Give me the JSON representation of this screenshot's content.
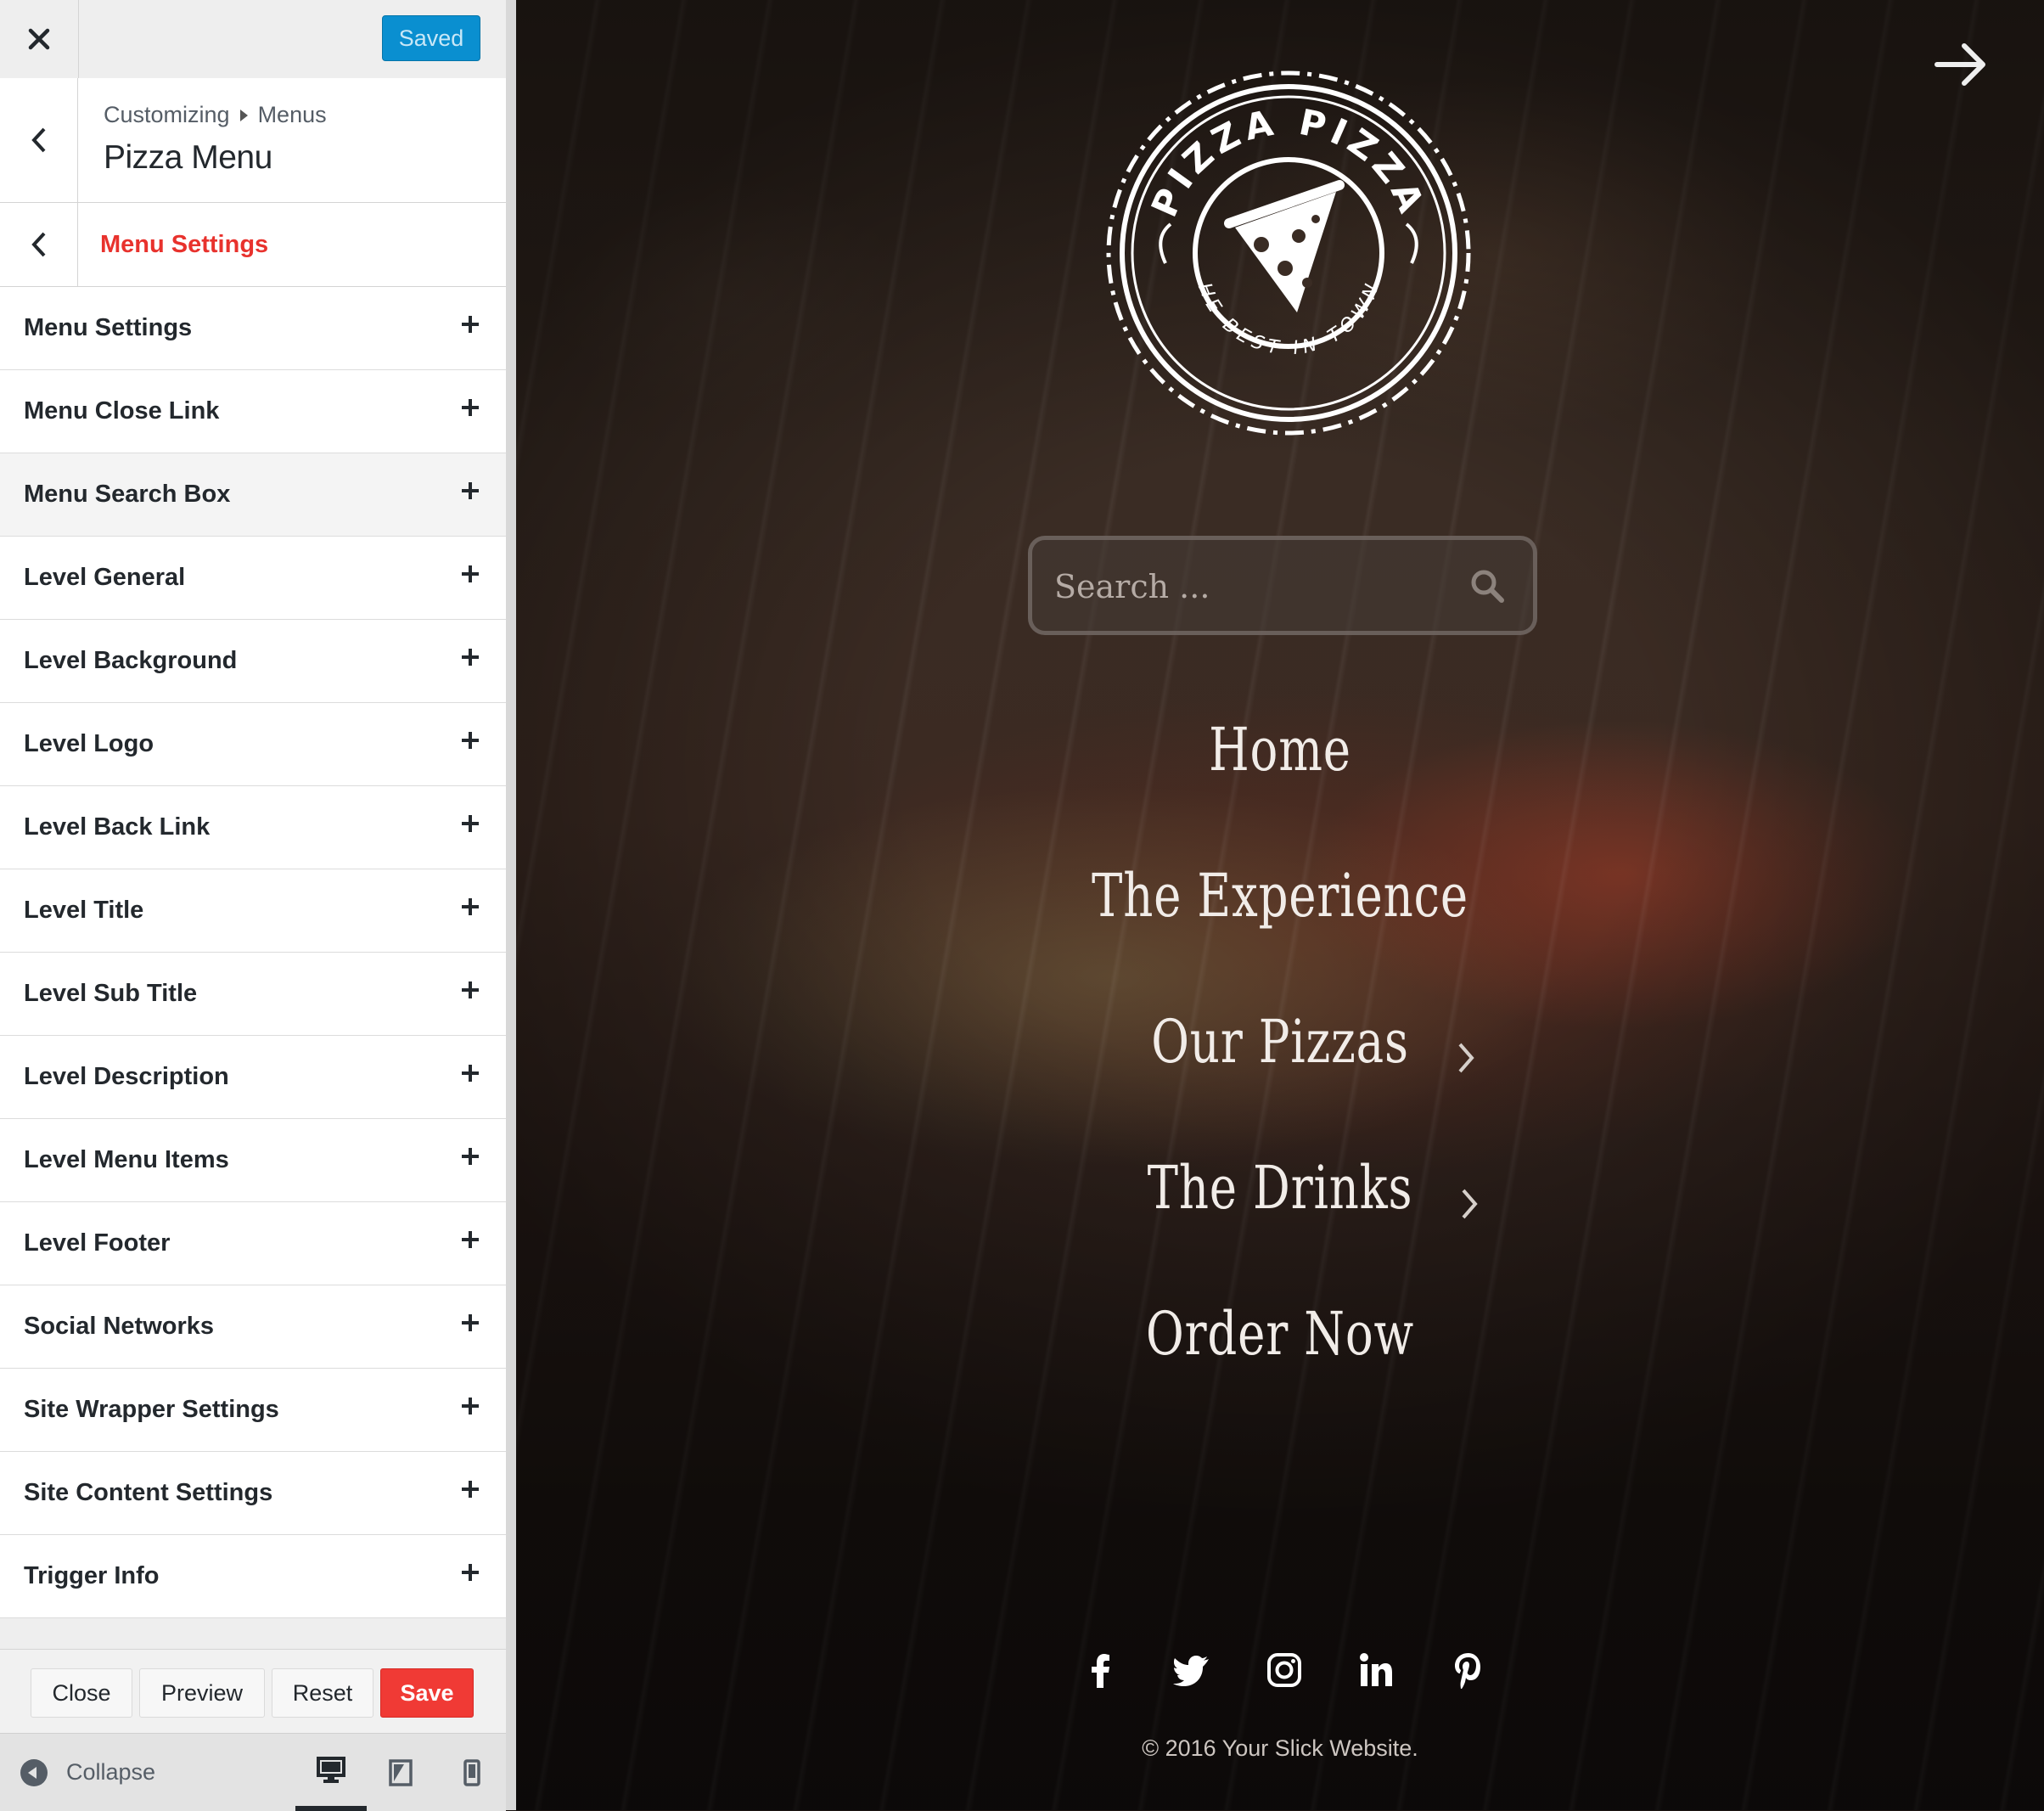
{
  "topbar": {
    "saved_label": "Saved"
  },
  "header": {
    "breadcrumb_root": "Customizing",
    "breadcrumb_leaf": "Menus",
    "panel_title": "Pizza Menu"
  },
  "section": {
    "title": "Menu Settings"
  },
  "settings": [
    "Menu Settings",
    "Menu Close Link",
    "Menu Search Box",
    "Level General",
    "Level Background",
    "Level Logo",
    "Level Back Link",
    "Level Title",
    "Level Sub Title",
    "Level Description",
    "Level Menu Items",
    "Level Footer",
    "Social Networks",
    "Site Wrapper Settings",
    "Site Content Settings",
    "Trigger Info"
  ],
  "actions": {
    "close": "Close",
    "preview": "Preview",
    "reset": "Reset",
    "save": "Save"
  },
  "footer": {
    "collapse": "Collapse",
    "active_device": "desktop"
  },
  "preview": {
    "logo": {
      "top_text": "PIZZA PIZZA",
      "bottom_text": "THE BEST IN TOWN!"
    },
    "search": {
      "placeholder": "Search ..."
    },
    "menu": [
      {
        "label": "Home",
        "has_children": false
      },
      {
        "label": "The Experience",
        "has_children": false
      },
      {
        "label": "Our Pizzas",
        "has_children": true
      },
      {
        "label": "The Drinks",
        "has_children": true
      },
      {
        "label": "Order Now",
        "has_children": false
      }
    ],
    "social_icons": [
      "facebook-icon",
      "twitter-icon",
      "instagram-icon",
      "linkedin-icon",
      "pinterest-icon"
    ],
    "copyright": "© 2016 Your Slick Website."
  },
  "colors": {
    "accent_red": "#e8322d",
    "save_red": "#f03a35",
    "saved_blue": "#0a8fd0",
    "sidebar_bg": "#eeeeee"
  }
}
